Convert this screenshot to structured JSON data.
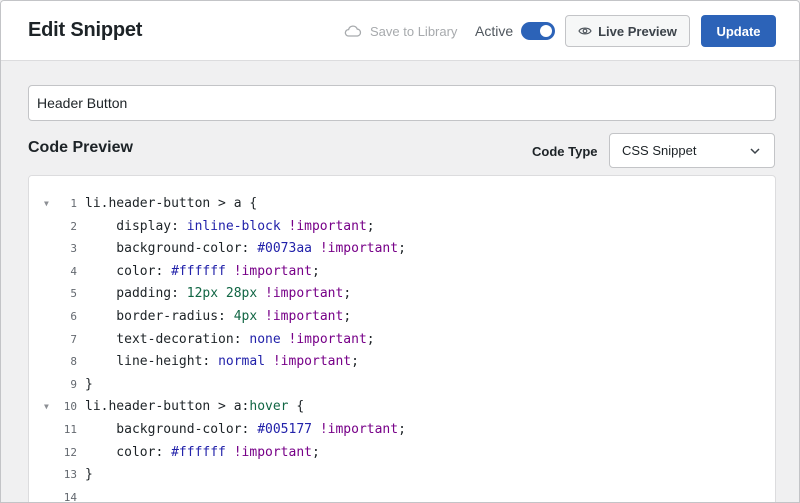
{
  "header": {
    "title": "Edit Snippet",
    "save_to_library": "Save to Library",
    "active_label": "Active",
    "active": true,
    "live_preview_label": "Live Preview",
    "update_label": "Update"
  },
  "snippet": {
    "title_value": "Header Button"
  },
  "code_preview": {
    "section_title": "Code Preview",
    "code_type_label": "Code Type",
    "code_type_value": "CSS Snippet"
  },
  "editor": {
    "lines": [
      {
        "n": "1",
        "fold": true,
        "tokens": [
          [
            "t-sel",
            "li.header-button"
          ],
          [
            "t-op",
            " > "
          ],
          [
            "t-sel",
            "a"
          ],
          [
            "t-op",
            " {"
          ]
        ]
      },
      {
        "n": "2",
        "fold": false,
        "tokens": [
          [
            "t-prop",
            "    display: "
          ],
          [
            "t-kw",
            "inline-block"
          ],
          [
            "t-op",
            " "
          ],
          [
            "t-imp",
            "!important"
          ],
          [
            "t-op",
            ";"
          ]
        ]
      },
      {
        "n": "3",
        "fold": false,
        "tokens": [
          [
            "t-prop",
            "    background-color: "
          ],
          [
            "t-hex",
            "#0073aa"
          ],
          [
            "t-op",
            " "
          ],
          [
            "t-imp",
            "!important"
          ],
          [
            "t-op",
            ";"
          ]
        ]
      },
      {
        "n": "4",
        "fold": false,
        "tokens": [
          [
            "t-prop",
            "    color: "
          ],
          [
            "t-hex",
            "#ffffff"
          ],
          [
            "t-op",
            " "
          ],
          [
            "t-imp",
            "!important"
          ],
          [
            "t-op",
            ";"
          ]
        ]
      },
      {
        "n": "5",
        "fold": false,
        "tokens": [
          [
            "t-prop",
            "    padding: "
          ],
          [
            "t-num",
            "12px 28px"
          ],
          [
            "t-op",
            " "
          ],
          [
            "t-imp",
            "!important"
          ],
          [
            "t-op",
            ";"
          ]
        ]
      },
      {
        "n": "6",
        "fold": false,
        "tokens": [
          [
            "t-prop",
            "    border-radius: "
          ],
          [
            "t-num",
            "4px"
          ],
          [
            "t-op",
            " "
          ],
          [
            "t-imp",
            "!important"
          ],
          [
            "t-op",
            ";"
          ]
        ]
      },
      {
        "n": "7",
        "fold": false,
        "tokens": [
          [
            "t-prop",
            "    text-decoration: "
          ],
          [
            "t-kw",
            "none"
          ],
          [
            "t-op",
            " "
          ],
          [
            "t-imp",
            "!important"
          ],
          [
            "t-op",
            ";"
          ]
        ]
      },
      {
        "n": "8",
        "fold": false,
        "tokens": [
          [
            "t-prop",
            "    line-height: "
          ],
          [
            "t-kw",
            "normal"
          ],
          [
            "t-op",
            " "
          ],
          [
            "t-imp",
            "!important"
          ],
          [
            "t-op",
            ";"
          ]
        ]
      },
      {
        "n": "9",
        "fold": false,
        "tokens": [
          [
            "t-op",
            "}"
          ]
        ]
      },
      {
        "n": "10",
        "fold": true,
        "tokens": [
          [
            "t-sel",
            "li.header-button"
          ],
          [
            "t-op",
            " > "
          ],
          [
            "t-sel",
            "a"
          ],
          [
            "t-op",
            ":"
          ],
          [
            "t-pseudo",
            "hover"
          ],
          [
            "t-op",
            " {"
          ]
        ]
      },
      {
        "n": "11",
        "fold": false,
        "tokens": [
          [
            "t-prop",
            "    background-color: "
          ],
          [
            "t-hex",
            "#005177"
          ],
          [
            "t-op",
            " "
          ],
          [
            "t-imp",
            "!important"
          ],
          [
            "t-op",
            ";"
          ]
        ]
      },
      {
        "n": "12",
        "fold": false,
        "tokens": [
          [
            "t-prop",
            "    color: "
          ],
          [
            "t-hex",
            "#ffffff"
          ],
          [
            "t-op",
            " "
          ],
          [
            "t-imp",
            "!important"
          ],
          [
            "t-op",
            ";"
          ]
        ]
      },
      {
        "n": "13",
        "fold": false,
        "tokens": [
          [
            "t-op",
            "}"
          ]
        ]
      },
      {
        "n": "14",
        "fold": false,
        "tokens": []
      }
    ]
  },
  "colors": {
    "accent": "#2c63b8",
    "background": "#f0f0f1"
  },
  "icons": {
    "save_to_library": "cloud-icon",
    "live_preview": "eye-icon",
    "code_type": "chevron-down-icon",
    "fold": "fold-arrow-icon"
  }
}
